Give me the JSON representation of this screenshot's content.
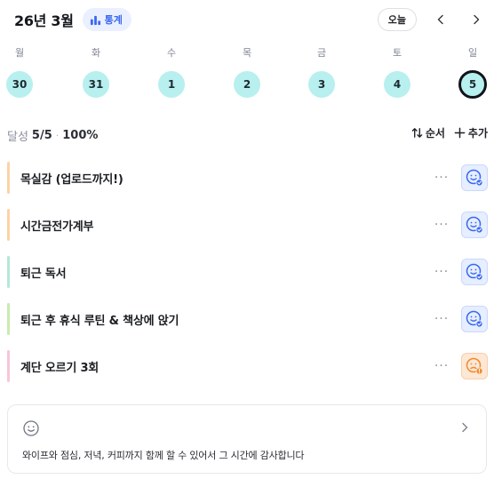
{
  "header": {
    "month_title": "26년 3월",
    "stats_label": "통계",
    "today_label": "오늘"
  },
  "week": {
    "days": [
      {
        "dow": "월",
        "date": "30"
      },
      {
        "dow": "화",
        "date": "31"
      },
      {
        "dow": "수",
        "date": "1"
      },
      {
        "dow": "목",
        "date": "2"
      },
      {
        "dow": "금",
        "date": "3"
      },
      {
        "dow": "토",
        "date": "4"
      },
      {
        "dow": "일",
        "date": "5",
        "selected": true
      }
    ]
  },
  "summary": {
    "label": "달성",
    "count": "5/5",
    "separator": "·",
    "percent": "100%"
  },
  "actions": {
    "order_label": "순서",
    "add_label": "추가"
  },
  "habits": [
    {
      "title": "목실감 (업로드까지!)",
      "color": "#fbd3a8",
      "mood": "happy",
      "mood_color": "blue"
    },
    {
      "title": "시간금전가계부",
      "color": "#fbd3a8",
      "mood": "happy",
      "mood_color": "blue"
    },
    {
      "title": "퇴근 독서",
      "color": "#b5e8d8",
      "mood": "happy",
      "mood_color": "blue"
    },
    {
      "title": "퇴근 후 휴식 루틴 & 책상에 앉기",
      "color": "#c9ebb0",
      "mood": "happy",
      "mood_color": "blue"
    },
    {
      "title": "계단 오르기 3회",
      "color": "#f8c6da",
      "mood": "sad",
      "mood_color": "orange"
    }
  ],
  "gratitude": {
    "text": "와이프와 점심, 저녁, 커피까지 함께 할 수 있어서 그 시간에 감사합니다"
  },
  "colors": {
    "accent_blue": "#3a68f0",
    "date_fill": "#b7f0ee",
    "mood_blue": "#3a68f0",
    "mood_orange": "#f08a2c"
  }
}
